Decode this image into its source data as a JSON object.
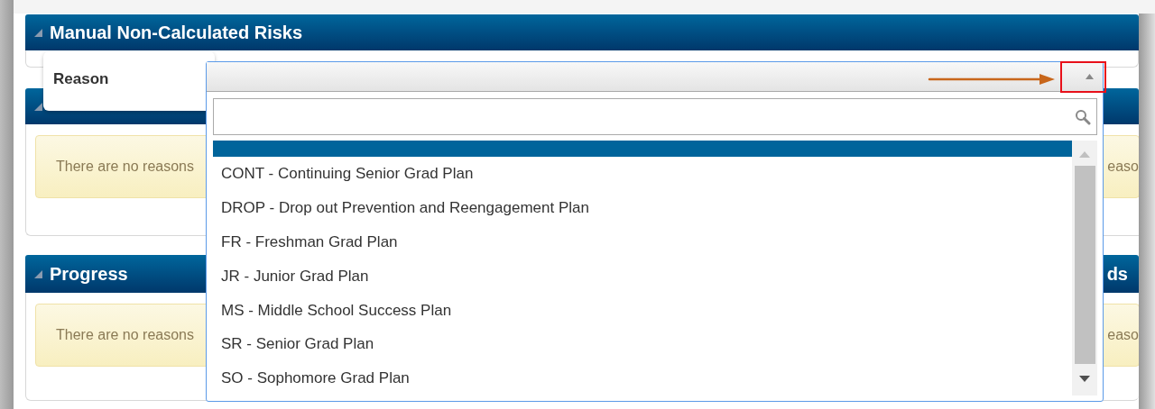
{
  "top_panel": {
    "title": "Manual Non-Calculated Risks",
    "expanded": true
  },
  "attendance_panel": {
    "expanded": true,
    "notice_left": "There are no reasons",
    "notice_right": "easo"
  },
  "progress_row": {
    "left_title": "Progress",
    "right_title": "ds",
    "expanded": true,
    "notice_left": "There are no reasons",
    "notice_right": "easo"
  },
  "reason_field": {
    "label": "Reason",
    "expanded": true,
    "options": [
      {
        "kind": "blank",
        "selected": true
      },
      {
        "kind": "text",
        "label": "CONT - Continuing Senior Grad Plan",
        "selected": false
      },
      {
        "kind": "text",
        "label": "DROP - Drop out Prevention and Reengagement Plan",
        "selected": false
      },
      {
        "kind": "text",
        "label": "FR - Freshman Grad Plan",
        "selected": false
      },
      {
        "kind": "text",
        "label": "JR - Junior Grad Plan",
        "selected": false
      },
      {
        "kind": "text",
        "label": "MS - Middle School Success Plan",
        "selected": false
      },
      {
        "kind": "text",
        "label": "SR - Senior Grad Plan",
        "selected": false
      },
      {
        "kind": "text",
        "label": "SO - Sophomore Grad Plan",
        "selected": false
      }
    ]
  }
}
